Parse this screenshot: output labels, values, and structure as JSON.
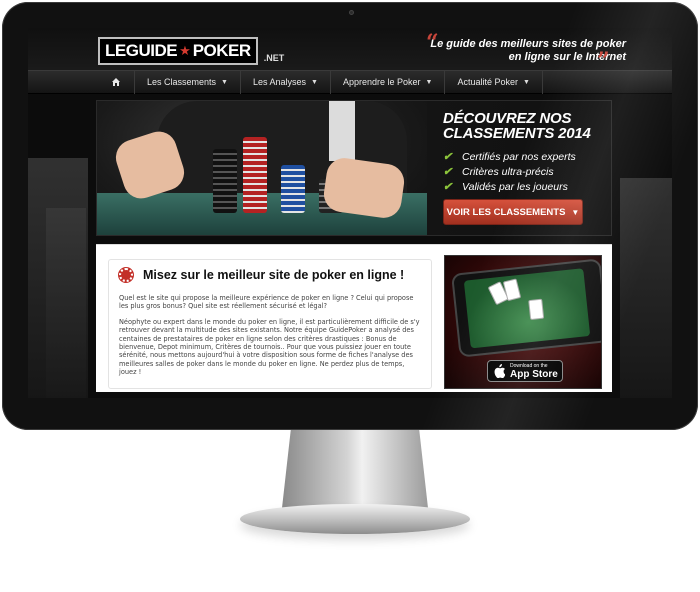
{
  "site": {
    "logo_text_left": "LEGUIDE",
    "logo_text_right": "POKER",
    "logo_net": ".NET",
    "tagline": "Le guide des meilleurs sites de poker en ligne sur le Internet"
  },
  "nav": {
    "items": [
      {
        "label": "Les Classements"
      },
      {
        "label": "Les Analyses"
      },
      {
        "label": "Apprendre le Poker"
      },
      {
        "label": "Actualité Poker"
      }
    ]
  },
  "hero": {
    "title_line1": "DÉCOUVREZ NOS",
    "title_line2": "CLASSEMENTS 2014",
    "features": [
      "Certifiés par nos experts",
      "Critères ultra-précis",
      "Validés par les joueurs"
    ],
    "cta_label": "VOIR LES CLASSEMENTS"
  },
  "article": {
    "title": "Misez sur le meilleur site de poker en ligne !",
    "paragraphs": [
      "Quel est le site qui propose la meilleure expérience de poker en ligne ? Celui qui propose les plus gros bonus? Quel site est réellement sécurisé et légal?",
      "Néophyte ou expert dans le monde du poker en ligne,  il est particulièrement difficile de s'y retrouver devant la multitude des sites existants. Notre équipe GuidePoker a analysé des centaines de prestataires de poker en ligne selon des critères drastiques : Bonus de bienvenue, Depot minimum, Critères de tournois.. Pour que vous puissiez jouer en toute sérénité, nous mettons aujourd'hui à votre disposition sous forme de fiches l'analyse des meilleures salles de poker dans le monde du poker en ligne. Ne perdez plus de temps, jouez !"
    ]
  },
  "appstore": {
    "top_label": "Download on the",
    "main_label": "App Store"
  },
  "colors": {
    "accent_red": "#c7453a",
    "cta_red": "#c2412f",
    "check_green": "#8cc43b"
  }
}
